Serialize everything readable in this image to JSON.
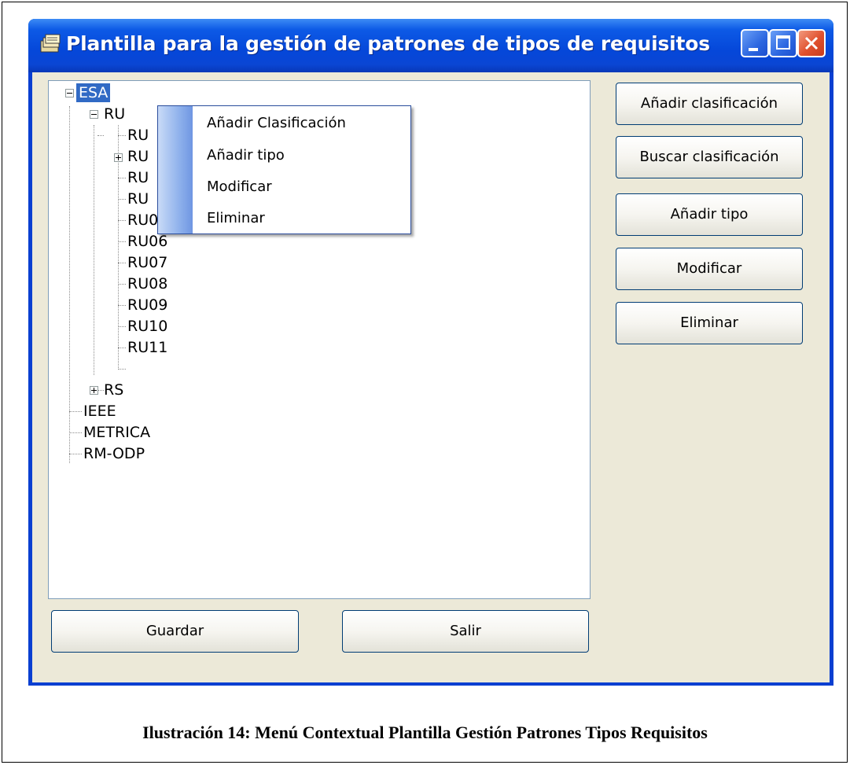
{
  "window": {
    "title": "Plantilla para la gestión de patrones de tipos de requisitos",
    "app_icon": "folder-stack-icon",
    "controls": {
      "minimize": "minimize-icon",
      "maximize": "maximize-icon",
      "close": "close-icon"
    }
  },
  "tree": {
    "nodes": [
      {
        "label": "ESA",
        "level": 0,
        "expanded": true,
        "selected": true
      },
      {
        "label": "RU",
        "level": 1,
        "expanded": true
      },
      {
        "label": "RU",
        "level": 2
      },
      {
        "label": "RU",
        "level": 2,
        "collapsed": true
      },
      {
        "label": "RU",
        "level": 2
      },
      {
        "label": "RU",
        "level": 2
      },
      {
        "label": "RU05",
        "level": 2
      },
      {
        "label": "RU06",
        "level": 2
      },
      {
        "label": "RU07",
        "level": 2
      },
      {
        "label": "RU08",
        "level": 2
      },
      {
        "label": "RU09",
        "level": 2
      },
      {
        "label": "RU10",
        "level": 2
      },
      {
        "label": "RU11",
        "level": 2
      },
      {
        "label": "RS",
        "level": 1,
        "collapsed": true
      },
      {
        "label": "IEEE",
        "level": 0
      },
      {
        "label": "METRICA",
        "level": 0
      },
      {
        "label": "RM-ODP",
        "level": 0
      }
    ]
  },
  "context_menu": {
    "items": [
      "Añadir Clasificación",
      "Añadir tipo",
      "Modificar",
      "Eliminar"
    ]
  },
  "side_buttons": [
    "Añadir clasificación",
    "Buscar clasificación",
    "Añadir tipo",
    "Modificar",
    "Eliminar"
  ],
  "bottom_buttons": {
    "save": "Guardar",
    "exit": "Salir"
  },
  "caption": "Ilustración 14: Menú Contextual Plantilla Gestión Patrones Tipos Requisitos",
  "colors": {
    "titlebar": "#0a46d4",
    "selection": "#316ac5",
    "client": "#ece9d8"
  }
}
